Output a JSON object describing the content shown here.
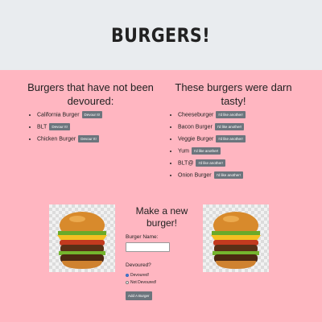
{
  "header": {
    "title": "BURGERS!"
  },
  "not_devoured": {
    "heading": "Burgers that have not been devoured:",
    "items": [
      {
        "name": "California Burger",
        "button": "Devour It!"
      },
      {
        "name": "BLT",
        "button": "Devour It!"
      },
      {
        "name": "Chicken Burger",
        "button": "Devour It!"
      }
    ]
  },
  "devoured": {
    "heading": "These burgers were darn tasty!",
    "items": [
      {
        "name": "Cheeseburger",
        "button": "I'd like another!"
      },
      {
        "name": "Bacon Burger",
        "button": "I'd like another!"
      },
      {
        "name": "Veggie Burger",
        "button": "I'd like another!"
      },
      {
        "name": "Yum",
        "button": "I'd like another!"
      },
      {
        "name": "BLT@",
        "button": "I'd like another!"
      },
      {
        "name": "Onion Burger",
        "button": "I'd like another!"
      }
    ]
  },
  "form": {
    "heading": "Make a new burger!",
    "name_label": "Burger Name:",
    "name_value": "",
    "devoured_label": "Devoured?",
    "options": [
      "Devoured!",
      "Not Devoured!"
    ],
    "selected": "Devoured!",
    "submit": "Add A Burger"
  },
  "icons": {
    "left_image": "burger-image",
    "right_image": "burger-image"
  },
  "colors": {
    "background": "#ffb6c1",
    "header": "#e9ecef",
    "button": "#6c757d"
  }
}
